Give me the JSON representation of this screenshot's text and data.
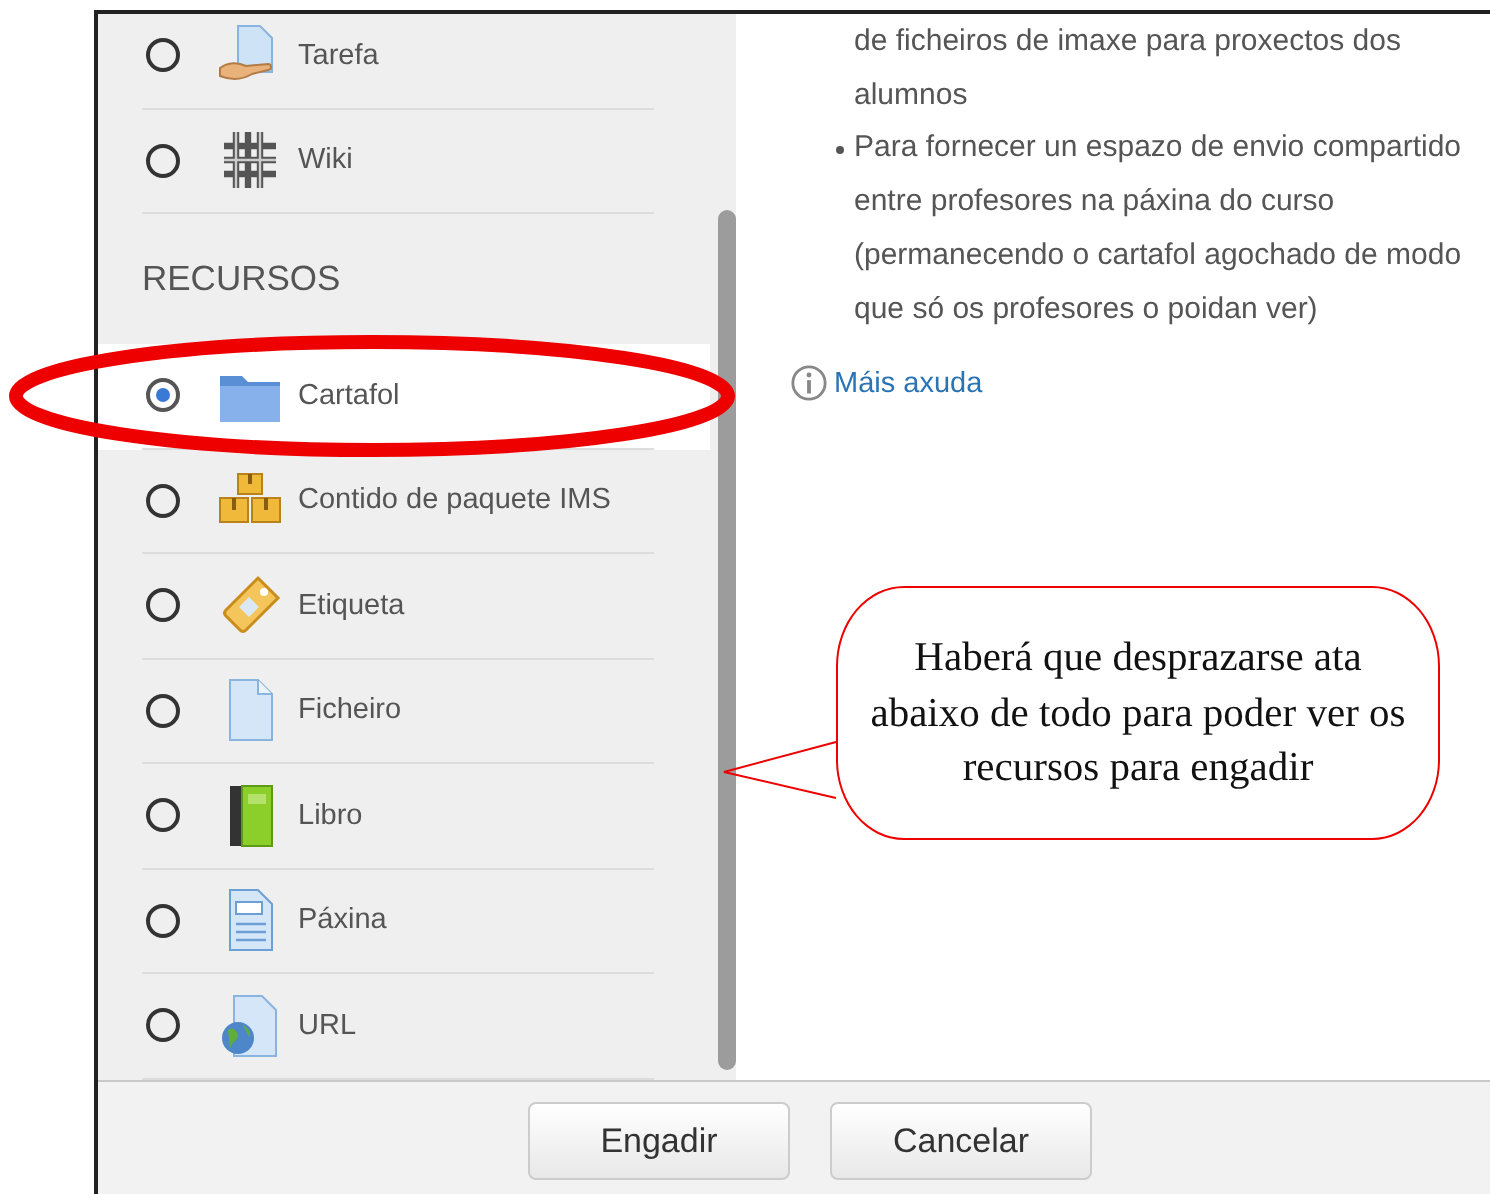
{
  "groups": [
    {
      "items": [
        {
          "label": "Tarefa",
          "selected": false
        },
        {
          "label": "Wiki",
          "selected": false
        }
      ]
    },
    {
      "heading": "RECURSOS",
      "items": [
        {
          "label": "Cartafol",
          "selected": true
        },
        {
          "label": "Contido de paquete IMS",
          "selected": false
        },
        {
          "label": "Etiqueta",
          "selected": false
        },
        {
          "label": "Ficheiro",
          "selected": false
        },
        {
          "label": "Libro",
          "selected": false
        },
        {
          "label": "Páxina",
          "selected": false
        },
        {
          "label": "URL",
          "selected": false
        }
      ]
    }
  ],
  "help": {
    "items": [
      {
        "text": "de ficheiros de imaxe para proxectos dos alumnos",
        "bullet": false
      },
      {
        "text": "Para fornecer un espazo de envio compartido entre profesores na páxina do curso (permanecendo o cartafol agochado de modo que só os profesores o poidan ver)",
        "bullet": true
      }
    ],
    "link": "Máis axuda"
  },
  "buttons": [
    "Engadir",
    "Cancelar"
  ],
  "callout": {
    "text": "Haberá que desprazarse ata abaixo de todo para poder ver os recursos para engadir"
  }
}
